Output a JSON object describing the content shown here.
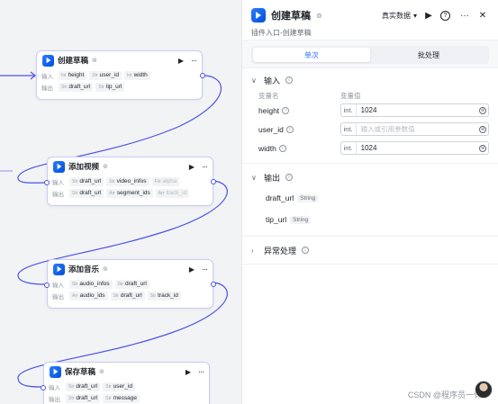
{
  "nodes": {
    "create_draft": {
      "title": "创建草稿",
      "inputs_label": "输入",
      "outputs_label": "输出",
      "inputs": [
        {
          "type": "Int",
          "name": "height"
        },
        {
          "type": "Str",
          "name": "user_id"
        },
        {
          "type": "Int",
          "name": "width"
        }
      ],
      "outputs": [
        {
          "type": "Str",
          "name": "draft_url"
        },
        {
          "type": "Str",
          "name": "tip_url"
        }
      ]
    },
    "add_videos": {
      "title": "添加视频",
      "inputs_label": "输入",
      "outputs_label": "输出",
      "inputs": [
        {
          "type": "Str",
          "name": "draft_url"
        },
        {
          "type": "Str",
          "name": "video_infos"
        },
        {
          "type": "Flo",
          "name": "alpha"
        }
      ],
      "outputs": [
        {
          "type": "Str",
          "name": "draft_url"
        },
        {
          "type": "Arr",
          "name": "segment_ids"
        },
        {
          "type": "Arr",
          "name": "track_id"
        }
      ]
    },
    "add_audios": {
      "title": "添加音乐",
      "inputs_label": "输入",
      "outputs_label": "输出",
      "inputs": [
        {
          "type": "Str",
          "name": "audio_infos"
        },
        {
          "type": "Str",
          "name": "draft_url"
        }
      ],
      "outputs": [
        {
          "type": "Arr",
          "name": "audio_ids"
        },
        {
          "type": "Str",
          "name": "draft_url"
        },
        {
          "type": "Str",
          "name": "track_id"
        }
      ]
    },
    "save_draft": {
      "title": "保存草稿",
      "inputs_label": "输入",
      "outputs_label": "输出",
      "inputs": [
        {
          "type": "Str",
          "name": "draft_url"
        },
        {
          "type": "Str",
          "name": "user_id"
        }
      ],
      "outputs": [
        {
          "type": "Str",
          "name": "draft_url"
        },
        {
          "type": "Str",
          "name": "message"
        }
      ]
    }
  },
  "panel": {
    "title": "创建草稿",
    "data_mode": "真实数据",
    "subtitle": "插件入口-创建草稿",
    "tabs": [
      "单次",
      "批处理"
    ],
    "input_section": "输入",
    "col_name": "变量名",
    "col_value": "变量值",
    "inputs": [
      {
        "name": "height",
        "type": "int.",
        "value": "1024",
        "placeholder": ""
      },
      {
        "name": "user_id",
        "type": "int.",
        "value": "",
        "placeholder": "输入或引用参数值"
      },
      {
        "name": "width",
        "type": "int.",
        "value": "1024",
        "placeholder": ""
      }
    ],
    "output_section": "输出",
    "outputs": [
      {
        "name": "draft_url",
        "type": "String"
      },
      {
        "name": "tip_url",
        "type": "String"
      }
    ],
    "error_section": "异常处理"
  },
  "watermark": "CSDN @程序员一休",
  "colors": {
    "accent": "#3370ff",
    "node_border": "#c9cdf5",
    "wire": "#4d53e8"
  }
}
